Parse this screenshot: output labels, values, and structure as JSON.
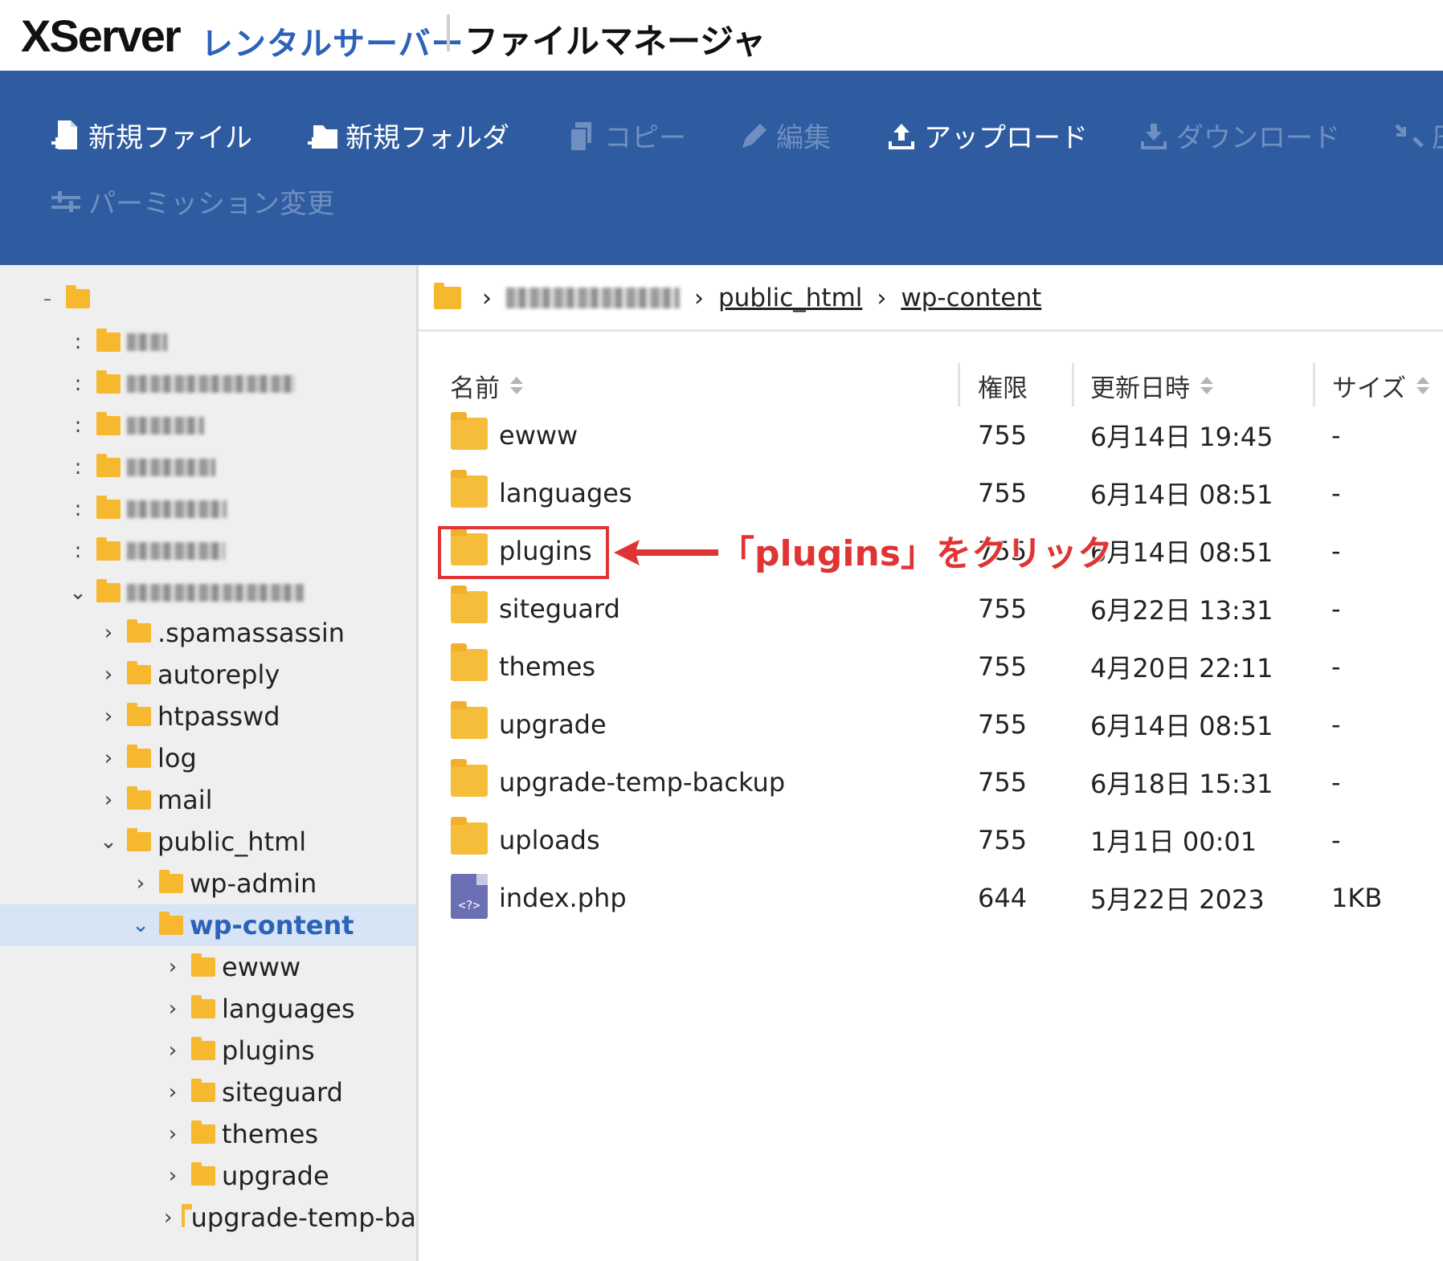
{
  "header": {
    "logo": "XServer",
    "subtitle": "レンタルサーバー",
    "app_title": "ファイルマネージャ"
  },
  "toolbar": {
    "new_file": "新規ファイル",
    "new_folder": "新規フォルダ",
    "copy": "コピー",
    "edit": "編集",
    "upload": "アップロード",
    "download": "ダウンロード",
    "compress_partial": "圧",
    "permission": "パーミッション変更"
  },
  "breadcrumb": {
    "items": [
      "public_html",
      "wp-content"
    ]
  },
  "table": {
    "headers": {
      "name": "名前",
      "permission": "権限",
      "modified": "更新日時",
      "size": "サイズ"
    },
    "rows": [
      {
        "type": "folder",
        "name": "ewww",
        "permission": "755",
        "modified": "6月14日 19:45",
        "size": "-"
      },
      {
        "type": "folder",
        "name": "languages",
        "permission": "755",
        "modified": "6月14日 08:51",
        "size": "-"
      },
      {
        "type": "folder",
        "name": "plugins",
        "permission": "755",
        "modified": "6月14日 08:51",
        "size": "-"
      },
      {
        "type": "folder",
        "name": "siteguard",
        "permission": "755",
        "modified": "6月22日 13:31",
        "size": "-"
      },
      {
        "type": "folder",
        "name": "themes",
        "permission": "755",
        "modified": "4月20日 22:11",
        "size": "-"
      },
      {
        "type": "folder",
        "name": "upgrade",
        "permission": "755",
        "modified": "6月14日 08:51",
        "size": "-"
      },
      {
        "type": "folder",
        "name": "upgrade-temp-backup",
        "permission": "755",
        "modified": "6月18日 15:31",
        "size": "-"
      },
      {
        "type": "folder",
        "name": "uploads",
        "permission": "755",
        "modified": "1月1日 00:01",
        "size": "-"
      },
      {
        "type": "file",
        "name": "index.php",
        "permission": "644",
        "modified": "5月22日 2023",
        "size": "1KB",
        "icon_text": "<?>"
      }
    ]
  },
  "sidebar": {
    "tree": [
      {
        "label": ".spamassassin",
        "caret": "›"
      },
      {
        "label": "autoreply",
        "caret": "›"
      },
      {
        "label": "htpasswd",
        "caret": "›"
      },
      {
        "label": "log",
        "caret": "›"
      },
      {
        "label": "mail",
        "caret": "›"
      },
      {
        "label": "public_html",
        "caret": "⌄"
      },
      {
        "label": "wp-admin",
        "caret": "›"
      },
      {
        "label": "wp-content",
        "caret": "⌄"
      },
      {
        "label": "ewww",
        "caret": "›"
      },
      {
        "label": "languages",
        "caret": "›"
      },
      {
        "label": "plugins",
        "caret": "›"
      },
      {
        "label": "siteguard",
        "caret": "›"
      },
      {
        "label": "themes",
        "caret": "›"
      },
      {
        "label": "upgrade",
        "caret": "›"
      },
      {
        "label": "upgrade-temp-ba",
        "caret": "›"
      }
    ]
  },
  "annotation": {
    "text": "「plugins」をクリック",
    "color": "#e03434"
  },
  "colors": {
    "toolbar_bg": "#2f5ca0",
    "brand_blue": "#2c62b8",
    "folder": "#f5b82e",
    "selected_row": "#d6e4f5"
  }
}
